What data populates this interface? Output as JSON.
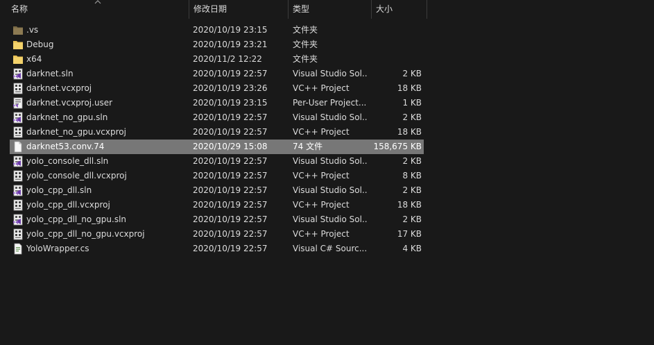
{
  "columns": {
    "name": "名称",
    "date": "修改日期",
    "type": "类型",
    "size": "大小"
  },
  "files": [
    {
      "icon": "folder-dark-icon",
      "name": ".vs",
      "date": "2020/10/19 23:15",
      "type": "文件夹",
      "size": ""
    },
    {
      "icon": "folder-icon",
      "name": "Debug",
      "date": "2020/10/19 23:21",
      "type": "文件夹",
      "size": ""
    },
    {
      "icon": "folder-icon",
      "name": "x64",
      "date": "2020/11/2 12:22",
      "type": "文件夹",
      "size": ""
    },
    {
      "icon": "vs-solution-icon",
      "name": "darknet.sln",
      "date": "2020/10/19 22:57",
      "type": "Visual Studio Sol...",
      "size": "2 KB"
    },
    {
      "icon": "vcxproj-icon",
      "name": "darknet.vcxproj",
      "date": "2020/10/19 23:26",
      "type": "VC++ Project",
      "size": "18 KB"
    },
    {
      "icon": "user-project-icon",
      "name": "darknet.vcxproj.user",
      "date": "2020/10/19 23:15",
      "type": "Per-User Project...",
      "size": "1 KB"
    },
    {
      "icon": "vs-solution-icon",
      "name": "darknet_no_gpu.sln",
      "date": "2020/10/19 22:57",
      "type": "Visual Studio Sol...",
      "size": "2 KB"
    },
    {
      "icon": "vcxproj-icon",
      "name": "darknet_no_gpu.vcxproj",
      "date": "2020/10/19 22:57",
      "type": "VC++ Project",
      "size": "18 KB"
    },
    {
      "icon": "blank-file-icon",
      "name": "darknet53.conv.74",
      "date": "2020/10/29 15:08",
      "type": "74 文件",
      "size": "158,675 KB",
      "selected": true
    },
    {
      "icon": "vs-solution-icon",
      "name": "yolo_console_dll.sln",
      "date": "2020/10/19 22:57",
      "type": "Visual Studio Sol...",
      "size": "2 KB"
    },
    {
      "icon": "vcxproj-icon",
      "name": "yolo_console_dll.vcxproj",
      "date": "2020/10/19 22:57",
      "type": "VC++ Project",
      "size": "8 KB"
    },
    {
      "icon": "vs-solution-icon",
      "name": "yolo_cpp_dll.sln",
      "date": "2020/10/19 22:57",
      "type": "Visual Studio Sol...",
      "size": "2 KB"
    },
    {
      "icon": "vcxproj-icon",
      "name": "yolo_cpp_dll.vcxproj",
      "date": "2020/10/19 22:57",
      "type": "VC++ Project",
      "size": "18 KB"
    },
    {
      "icon": "vs-solution-icon",
      "name": "yolo_cpp_dll_no_gpu.sln",
      "date": "2020/10/19 22:57",
      "type": "Visual Studio Sol...",
      "size": "2 KB"
    },
    {
      "icon": "vcxproj-icon",
      "name": "yolo_cpp_dll_no_gpu.vcxproj",
      "date": "2020/10/19 22:57",
      "type": "VC++ Project",
      "size": "17 KB"
    },
    {
      "icon": "csharp-file-icon",
      "name": "YoloWrapper.cs",
      "date": "2020/10/19 22:57",
      "type": "Visual C# Sourc...",
      "size": "4 KB"
    }
  ],
  "colors": {
    "background": "#191919",
    "selection": "#777777",
    "text": "#dcdcdc",
    "folder": "#e8c054"
  }
}
